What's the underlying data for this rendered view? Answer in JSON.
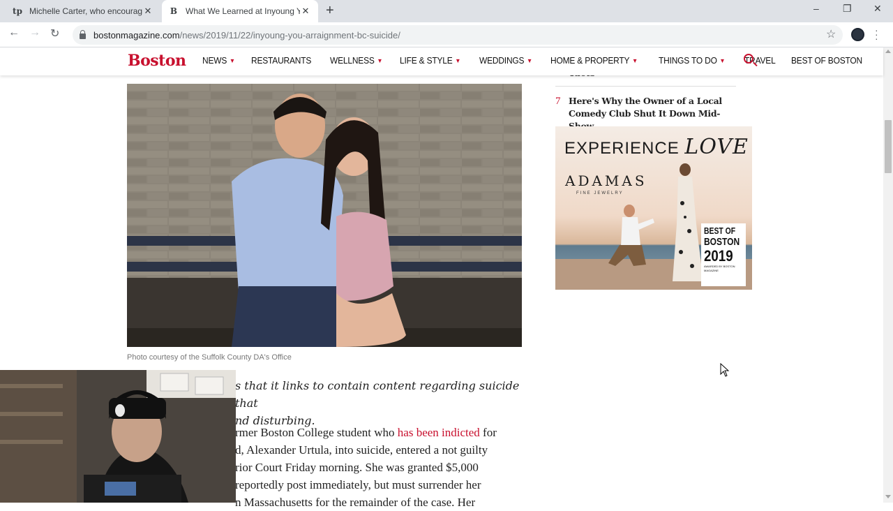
{
  "browser": {
    "tabs": [
      {
        "favicon": "tp",
        "title": "Michelle Carter, who encouraged",
        "active": false
      },
      {
        "favicon": "B",
        "title": "What We Learned at Inyoung Yo",
        "active": true
      }
    ],
    "new_tab": "+",
    "address": {
      "host": "bostonmagazine.com",
      "path": "/news/2019/11/22/inyoung-you-arraignment-bc-suicide/"
    },
    "window_controls": {
      "minimize": "–",
      "maximize": "❐",
      "close": "✕"
    }
  },
  "site": {
    "logo": "Boston",
    "nav": [
      {
        "label": "NEWS",
        "has_caret": true
      },
      {
        "label": "RESTAURANTS",
        "has_caret": false
      },
      {
        "label": "WELLNESS",
        "has_caret": true
      },
      {
        "label": "LIFE & STYLE",
        "has_caret": true
      },
      {
        "label": "WEDDINGS",
        "has_caret": true
      },
      {
        "label": "HOME & PROPERTY",
        "has_caret": true
      },
      {
        "label": "THINGS TO DO",
        "has_caret": true
      },
      {
        "label": "TRAVEL",
        "has_caret": false
      },
      {
        "label": "BEST OF BOSTON",
        "has_caret": false
      }
    ],
    "caret_glyph": "▼",
    "accent_color": "#c8102e"
  },
  "article": {
    "caption": "Photo courtesy of the Suffolk County DA's Office",
    "intro_lines": [
      "s that it links to contain content regarding suicide that",
      "nd disturbing."
    ],
    "body": {
      "line1_pre": "rmer Boston College student who ",
      "line1_link": "has been indicted",
      "line1_post": " for",
      "lines": [
        "d, Alexander Urtula, into suicide, entered a not guilty",
        "rior Court Friday morning. She was granted $5,000",
        "reportedly post immediately, but must surrender her",
        "n Massachusetts for the remainder of the case. Her"
      ]
    }
  },
  "sidebar": {
    "prev_fragment": "Tacts",
    "item_number": "7",
    "item_title": "Here's Why the Owner of a Local Comedy Club Shut It Down Mid-Show",
    "ad": {
      "headline_plain": "EXPERIENCE",
      "headline_italic": "LOVE",
      "brand": "ADAMAS",
      "brand_sub": "FINE JEWELRY",
      "badge": {
        "line1": "BEST OF",
        "line2": "BOSTON",
        "line3": "2019",
        "fine_print": "AWARDED BY BOSTON MAGAZINE"
      }
    }
  }
}
